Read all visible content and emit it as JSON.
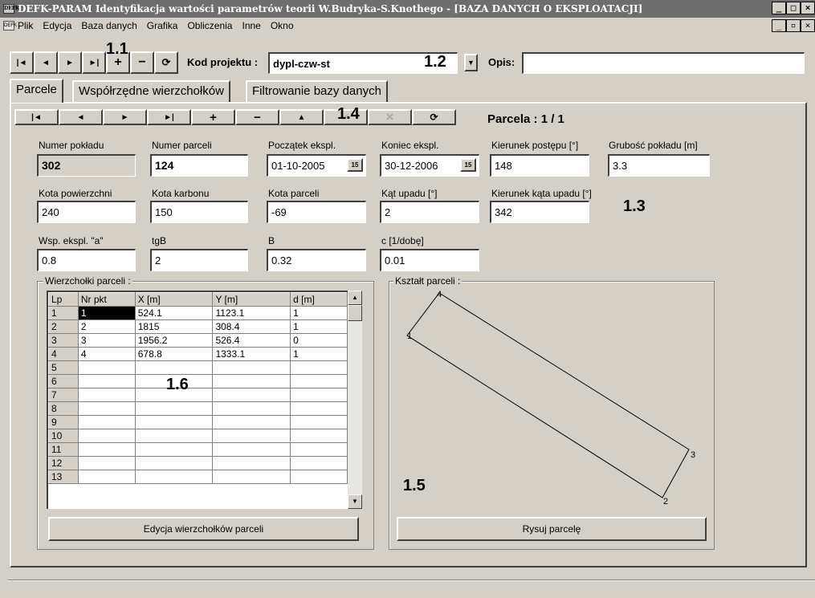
{
  "window": {
    "title": "DEFK-PARAM Identyfikacja wartości parametrów teorii W.Budryka-S.Knothego - [BAZA DANYCH O EKSPLOATACJI]",
    "app_icon_text": "DEFK",
    "minimize": "_",
    "maximize": "□",
    "close": "×",
    "mdi_restore": "▫"
  },
  "menu": [
    "Plik",
    "Edycja",
    "Baza danych",
    "Grafika",
    "Obliczenia",
    "Inne",
    "Okno"
  ],
  "toolbar": {
    "nav": [
      "|◄",
      "◄",
      "►",
      "►|",
      "+",
      "−",
      "⟳"
    ],
    "project_label": "Kod projektu :",
    "project_value": "dypl-czw-st",
    "desc_label": "Opis:",
    "desc_value": "",
    "dropdown": "▼"
  },
  "tabs": [
    "Parcele",
    "Współrzędne wierzchołków",
    "Filtrowanie bazy danych"
  ],
  "navbar": {
    "buttons": [
      "|◄",
      "◄",
      "►",
      "►|",
      "+",
      "−",
      "▲",
      "✓",
      "✕",
      "⟳"
    ],
    "record_label": "Parcela : 1 / 1"
  },
  "marks": {
    "m11": "1.1",
    "m12": "1.2",
    "m13": "1.3",
    "m14": "1.4",
    "m15": "1.5",
    "m16": "1.6"
  },
  "fields": {
    "numer_pokladu": {
      "label": "Numer pokładu",
      "value": "302"
    },
    "numer_parceli": {
      "label": "Numer parceli",
      "value": "124"
    },
    "poczatek": {
      "label": "Początek ekspl.",
      "value": "01-10-2005"
    },
    "koniec": {
      "label": "Koniec ekspl.",
      "value": "30-12-2006"
    },
    "kierunek_postepu": {
      "label": "Kierunek postępu [°]",
      "value": "148"
    },
    "grubosc": {
      "label": "Grubość pokładu [m]",
      "value": "3.3"
    },
    "kota_powierzchni": {
      "label": "Kota powierzchni",
      "value": "240"
    },
    "kota_karbonu": {
      "label": "Kota karbonu",
      "value": "150"
    },
    "kota_parceli": {
      "label": "Kota parceli",
      "value": "-69"
    },
    "kat_upadu": {
      "label": "Kąt upadu [°]",
      "value": "2"
    },
    "kierunek_kata": {
      "label": "Kierunek kąta upadu [°]",
      "value": "342"
    },
    "wsp_a": {
      "label": "Wsp. ekspl. \"a\"",
      "value": "0.8"
    },
    "tgb": {
      "label": "tgB",
      "value": "2"
    },
    "b": {
      "label": "B",
      "value": "0.32"
    },
    "c": {
      "label": "c [1/dobę]",
      "value": "0.01"
    },
    "calendar_icon_text": "15"
  },
  "vertices": {
    "group_label": "Wierzchołki parceli :",
    "columns": [
      "Lp",
      "Nr pkt",
      "X [m]",
      "Y [m]",
      "d [m]"
    ],
    "rows": [
      [
        "1",
        "1",
        "524.1",
        "1123.1",
        "1"
      ],
      [
        "2",
        "2",
        "1815",
        "308.4",
        "1"
      ],
      [
        "3",
        "3",
        "1956.2",
        "526.4",
        "0"
      ],
      [
        "4",
        "4",
        "678.8",
        "1333.1",
        "1"
      ],
      [
        "5",
        "",
        "",
        "",
        ""
      ],
      [
        "6",
        "",
        "",
        "",
        ""
      ],
      [
        "7",
        "",
        "",
        "",
        ""
      ],
      [
        "8",
        "",
        "",
        "",
        ""
      ],
      [
        "9",
        "",
        "",
        "",
        ""
      ],
      [
        "10",
        "",
        "",
        "",
        ""
      ],
      [
        "11",
        "",
        "",
        "",
        ""
      ],
      [
        "12",
        "",
        "",
        "",
        ""
      ],
      [
        "13",
        "",
        "",
        "",
        ""
      ]
    ],
    "edit_button": "Edycja wierzchołków parceli"
  },
  "shape": {
    "group_label": "Kształt parceli :",
    "point_labels": [
      "1",
      "2",
      "3",
      "4"
    ],
    "draw_button": "Rysuj parcelę"
  }
}
